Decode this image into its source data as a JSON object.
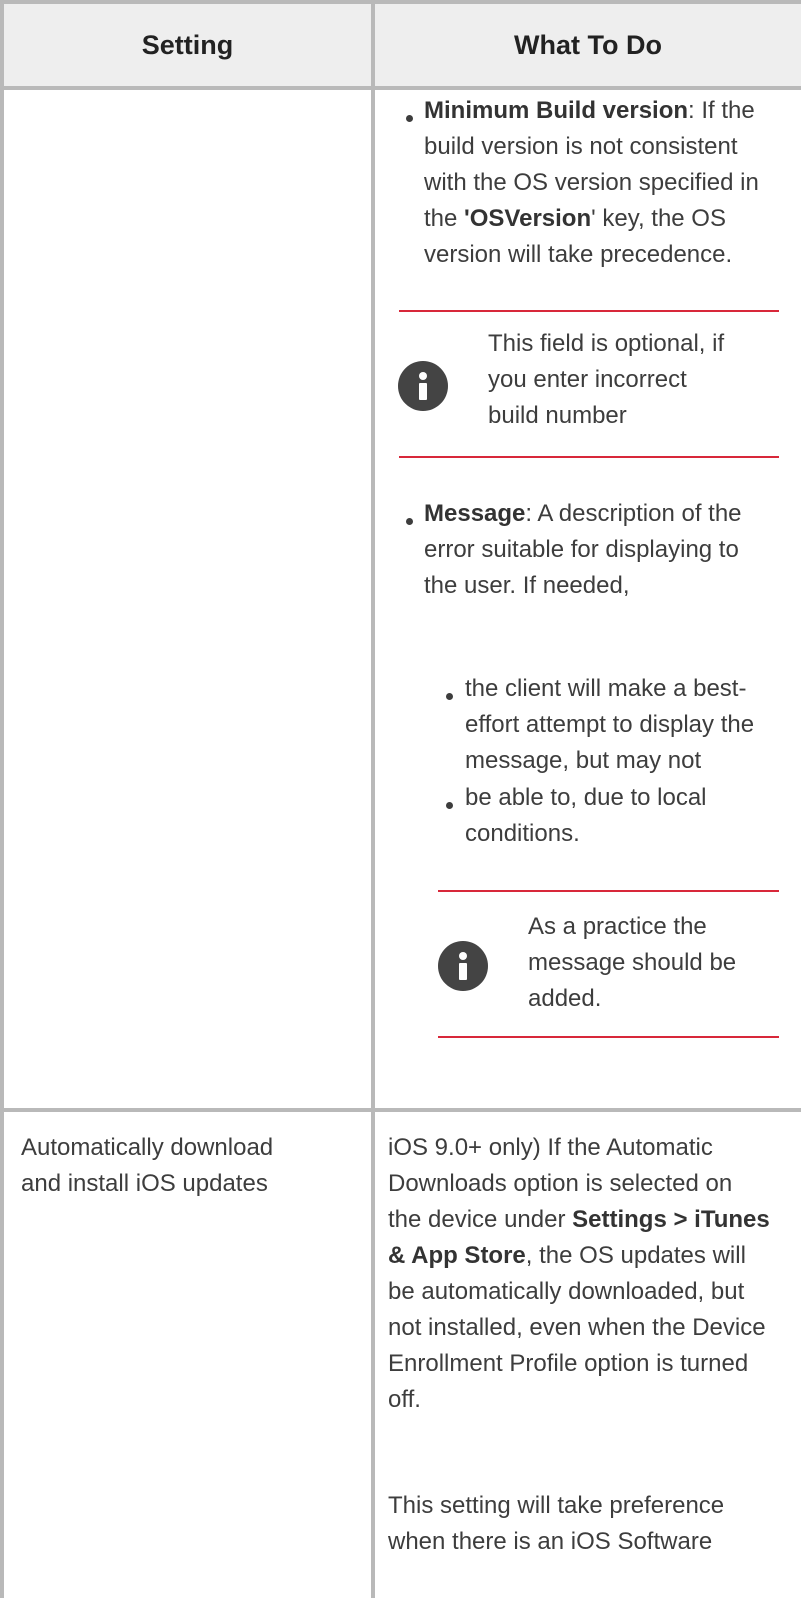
{
  "header": {
    "setting": "Setting",
    "what_to_do": "What To Do"
  },
  "row1": {
    "bullet_min_build": {
      "label": "Minimum Build version",
      "text_a": ": If the",
      "line2": "build version is not consistent",
      "line3": "with the OS version specified in",
      "line4_pre": "the ",
      "line4_key": "'OSVersion",
      "line4_post": "' key, the OS",
      "line5": "version will take precedence."
    },
    "note1": {
      "line1": "This field is optional, if",
      "line2": "you enter incorrect",
      "line3": "build number"
    },
    "bullet_message": {
      "label": "Message",
      "text_a": ": A description of the",
      "line2": "error suitable for displaying to",
      "line3": "the user. If needed,"
    },
    "sub_bullet_1": {
      "line1": "the client will make a best-",
      "line2": "effort attempt to display the",
      "line3": "message, but may not"
    },
    "sub_bullet_2": {
      "line1": "be able to, due to local",
      "line2": "conditions."
    },
    "note2": {
      "line1": "As a practice the",
      "line2": "message should be",
      "line3": "added."
    }
  },
  "row2": {
    "setting": {
      "line1": "Automatically download",
      "line2": "and install iOS updates"
    },
    "desc": {
      "line1": "iOS 9.0+ only) If the Automatic",
      "line2": "Downloads option is selected on",
      "line3_pre": "the device under ",
      "line3_bold": "Settings > iTunes",
      "line4_bold": "& App Store",
      "line4_post": ", the OS updates will",
      "line5": "be automatically downloaded, but",
      "line6": "not installed, even when the Device",
      "line7": "Enrollment Profile option is turned",
      "line8": "off."
    },
    "desc2": {
      "line1": "This setting will take preference",
      "line2": "when there is an iOS Software"
    }
  },
  "colors": {
    "border": "#b9b9b9",
    "header_bg": "#eeeeee",
    "note_rule": "#d8283a",
    "info_icon": "#444444",
    "text": "#3d3d3d"
  }
}
